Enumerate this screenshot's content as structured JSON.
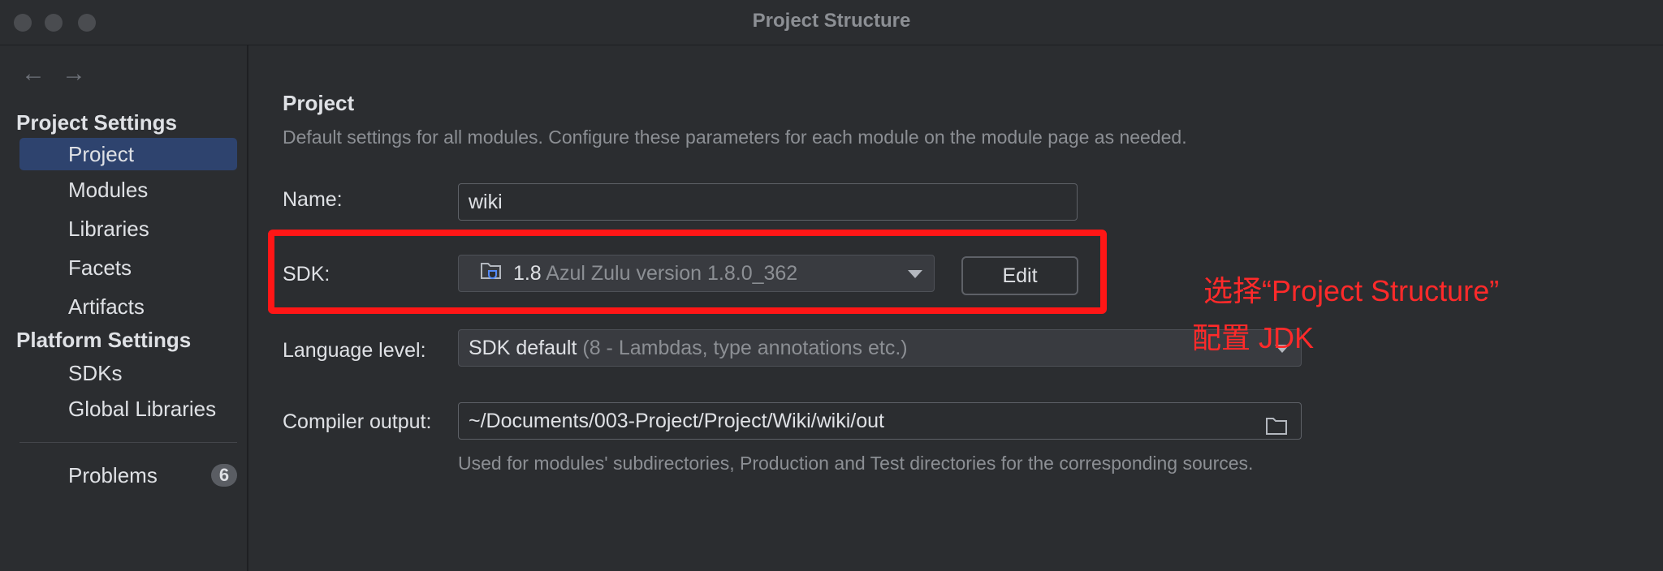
{
  "window": {
    "title": "Project Structure"
  },
  "nav": {
    "back_icon": "←",
    "forward_icon": "→"
  },
  "sidebar": {
    "project_settings_header": "Project Settings",
    "project_items": [
      {
        "label": "Project",
        "selected": true
      },
      {
        "label": "Modules"
      },
      {
        "label": "Libraries"
      },
      {
        "label": "Facets"
      },
      {
        "label": "Artifacts"
      }
    ],
    "platform_settings_header": "Platform Settings",
    "platform_items": [
      {
        "label": "SDKs"
      },
      {
        "label": "Global Libraries"
      }
    ],
    "problems": {
      "label": "Problems",
      "count": "6"
    }
  },
  "main": {
    "title": "Project",
    "description": "Default settings for all modules. Configure these parameters for each module on the module page as needed.",
    "name": {
      "label": "Name:",
      "value": "wiki"
    },
    "sdk": {
      "label": "SDK:",
      "version": "1.8",
      "detail": "Azul Zulu version 1.8.0_362",
      "edit_label": "Edit",
      "icon": "folder-coffee-icon"
    },
    "language_level": {
      "label": "Language level:",
      "value": "SDK default",
      "detail": "(8 - Lambdas, type annotations etc.)"
    },
    "compiler_output": {
      "label": "Compiler output:",
      "value": "~/Documents/003-Project/Project/Wiki/wiki/out",
      "hint": "Used for modules' subdirectories, Production and Test directories for the corresponding sources."
    }
  },
  "annotation": {
    "line1": "选择“Project Structure”",
    "line2": "配置 JDK",
    "color": "#ff1616"
  },
  "colors": {
    "selection": "#2e436e",
    "background": "#2b2d30"
  }
}
